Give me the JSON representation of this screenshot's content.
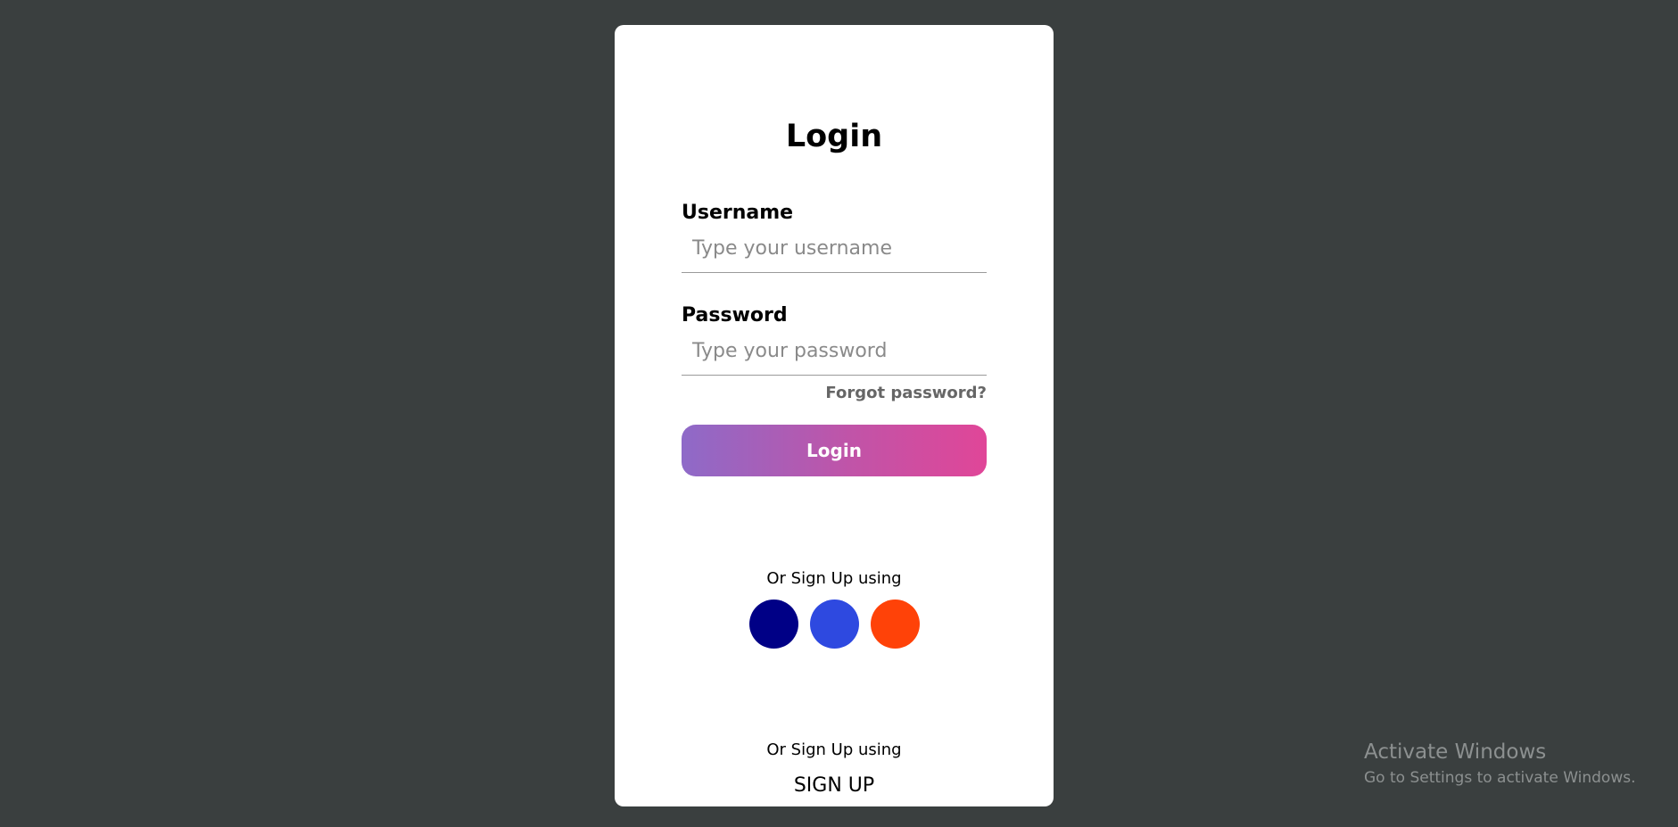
{
  "form": {
    "title": "Login",
    "username": {
      "label": "Username",
      "placeholder": "Type your username",
      "value": ""
    },
    "password": {
      "label": "Password",
      "placeholder": "Type your password",
      "value": ""
    },
    "forgot_label": "Forgot password?",
    "login_label": "Login",
    "social_prompt": "Or Sign Up using",
    "social_buttons": [
      {
        "icon": "facebook-icon",
        "color": "#000086"
      },
      {
        "icon": "twitter-icon",
        "color": "#2e49e0"
      },
      {
        "icon": "google-icon",
        "color": "#ff4208"
      }
    ],
    "signup_prompt": "Or Sign Up using",
    "signup_label": "SIGN UP"
  },
  "theme": {
    "page_bg": "#3a3f3f",
    "card_bg": "#ffffff",
    "gradient_start": "#8e6ac8",
    "gradient_end": "#e04698"
  },
  "watermark": {
    "title": "Activate Windows",
    "subtitle": "Go to Settings to activate Windows."
  }
}
